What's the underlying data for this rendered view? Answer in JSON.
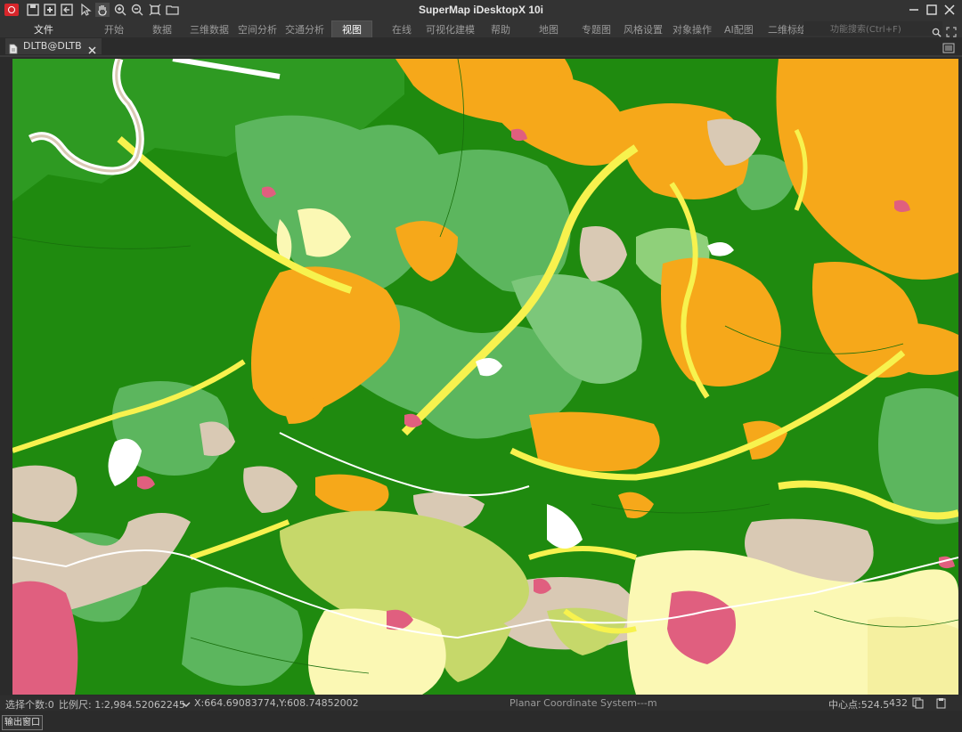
{
  "window": {
    "title": "SuperMap iDesktopX 10i"
  },
  "menus": [
    {
      "label": "文件"
    },
    {
      "label": "开始"
    },
    {
      "label": "数据"
    },
    {
      "label": "三维数据"
    },
    {
      "label": "空间分析"
    },
    {
      "label": "交通分析"
    },
    {
      "label": "视图"
    },
    {
      "label": "在线"
    },
    {
      "label": "可视化建模"
    },
    {
      "label": "帮助"
    },
    {
      "label": "地图"
    },
    {
      "label": "专题图"
    },
    {
      "label": "风格设置"
    },
    {
      "label": "对象操作"
    },
    {
      "label": "AI配图"
    },
    {
      "label": "二维标绘"
    }
  ],
  "search": {
    "placeholder": "功能搜索(Ctrl+F)"
  },
  "tab": {
    "label": "DLTB@DLTB"
  },
  "status": {
    "selected": "选择个数:0",
    "scale": "比例尺: 1:2,984.52062245",
    "coords": "X:664.69083774,Y:608.74852002",
    "coord_system": "Planar Coordinate System---m",
    "center": "中心点:524.5",
    "center_val": "432"
  },
  "output": {
    "label": "输出窗口"
  },
  "map_colors": {
    "forest": "#1f8a0f",
    "grass": "#5cb65e",
    "light_green": "#8fd07a",
    "orange": "#f6a81a",
    "yellow": "#f7f24e",
    "pale_yellow": "#fbf8b4",
    "beige": "#d9c9b4",
    "olive": "#c6d86a",
    "pink": "#e05f7f",
    "white": "#ffffff"
  }
}
